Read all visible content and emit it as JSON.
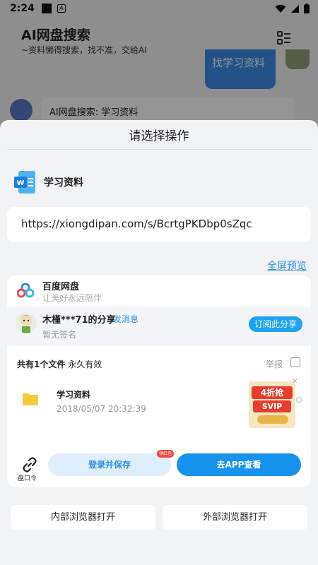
{
  "status_bar": {
    "time": "2:24"
  },
  "background_app": {
    "title": "AI网盘搜索",
    "subtitle": "~资料懒得搜索，找不准，交给AI",
    "user_message": "找学习资料",
    "bot_message": "AI网盘搜索: 学习资料"
  },
  "sheet": {
    "title": "请选择操作",
    "file_name": "学习资料",
    "url": "https://xiongdipan.com/s/BcrtgPKDbp0sZqc",
    "fullscreen_label": "全屏预览"
  },
  "share_card": {
    "service_name": "百度网盘",
    "service_slogan": "让美好永远陪伴",
    "sharer_name": "木槿***71的分享",
    "send_message_label": "发消息",
    "sharer_signature": "暂无签名",
    "subscribe_label": "订阅此分享",
    "files_summary_count": "共有1个文件",
    "files_summary_validity": "永久有效",
    "report_label": "举报",
    "files": [
      {
        "name": "学习资料",
        "date": "2018/05/07 20:32:39"
      }
    ],
    "ad": {
      "line1": "4折抢",
      "line2": "SVIP"
    },
    "link_label": "盘口令",
    "save_label": "登录并保存",
    "save_badge": "领红包",
    "open_app_label": "去APP查看"
  },
  "actions": {
    "internal_browser": "内部浏览器打开",
    "external_browser": "外部浏览器打开"
  },
  "colors": {
    "accent": "#2f8fe4",
    "primary_button": "#1793ee",
    "dim_overlay": "rgba(0,0,0,0.42)"
  }
}
